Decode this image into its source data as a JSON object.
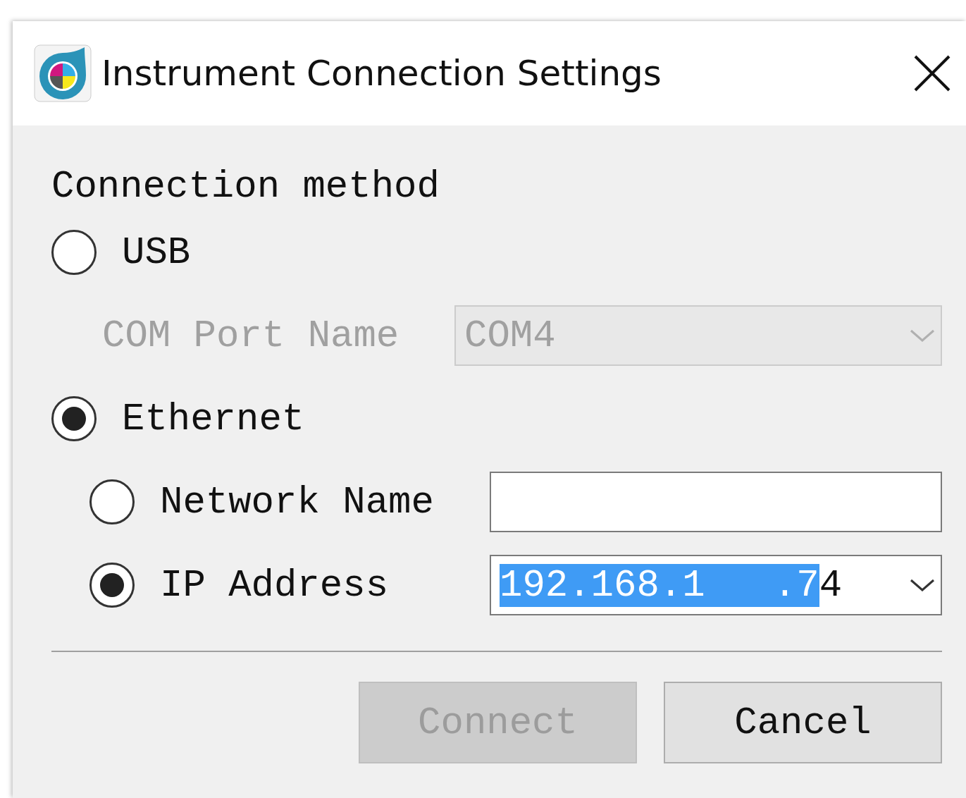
{
  "window": {
    "title": "Instrument Connection Settings"
  },
  "group_label": "Connection method",
  "usb": {
    "label": "USB",
    "selected": false,
    "com_port": {
      "label": "COM Port Name",
      "value": "COM4",
      "disabled": true
    }
  },
  "ethernet": {
    "label": "Ethernet",
    "selected": true,
    "options": [
      {
        "kind": "text",
        "label": "Network Name",
        "selected": false
      },
      {
        "kind": "combo",
        "label": "IP Address",
        "selected": true,
        "selected_text": "192.168.1   .7",
        "text_after": "4"
      }
    ]
  },
  "buttons": [
    {
      "label": "Connect",
      "disabled": true
    },
    {
      "label": "Cancel",
      "disabled": false
    }
  ]
}
